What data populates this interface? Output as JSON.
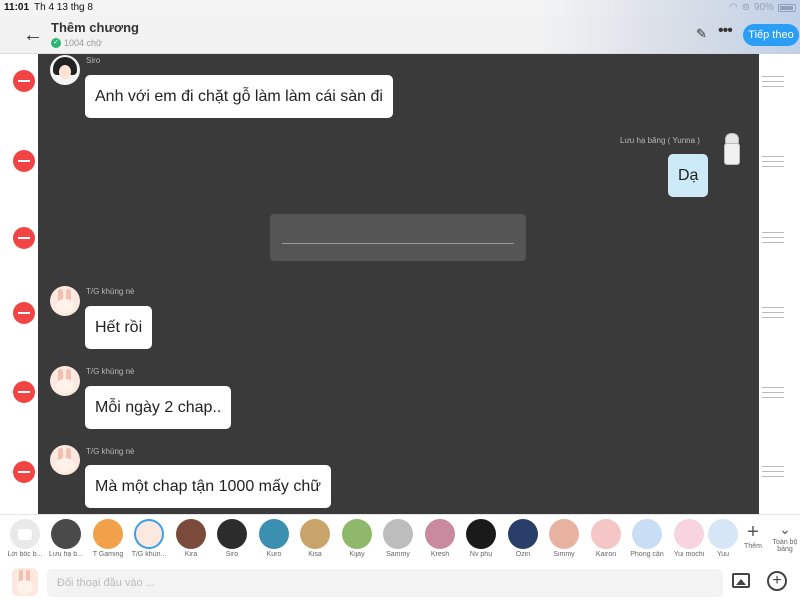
{
  "status_bar": {
    "time": "11:01",
    "date": "Th 4 13 thg 8",
    "battery": "90%"
  },
  "header": {
    "title": "Thêm chương",
    "word_count": "1004 chữ",
    "next_label": "Tiếp theo",
    "back_glyph": "←",
    "edit_glyph": "✎",
    "more_glyph": "•••"
  },
  "messages": [
    {
      "sender": "Siro",
      "text": "Anh với em đi chặt gỗ làm làm cái sàn đi",
      "side": "left",
      "avatar": "siro"
    },
    {
      "sender": "Lưu hạ băng ( Yunna )",
      "text": "Dạ",
      "side": "right",
      "avatar": "yunna"
    },
    {
      "type": "divider"
    },
    {
      "sender": "T/G khùng nè",
      "text": "Hết rồi",
      "side": "left",
      "avatar": "bunny"
    },
    {
      "sender": "T/G khùng nè",
      "text": "Mỗi ngày 2 chap..",
      "side": "left",
      "avatar": "bunny"
    },
    {
      "sender": "T/G khùng nè",
      "text": "Mà một chap tận 1000 mấy chữ",
      "side": "left",
      "avatar": "bunny"
    }
  ],
  "characters": [
    {
      "name": "Lời bốc b...",
      "color": "#e9e9e9"
    },
    {
      "name": "Lưu hạ b...",
      "color": "#4a4a4a"
    },
    {
      "name": "T Gaming",
      "color": "#f2a14a"
    },
    {
      "name": "T/G khùn...",
      "color": "#fbe9e0"
    },
    {
      "name": "Kira",
      "color": "#7a4a3a"
    },
    {
      "name": "Siro",
      "color": "#2c2c2c"
    },
    {
      "name": "Kuro",
      "color": "#3b8fb0"
    },
    {
      "name": "Kisa",
      "color": "#c9a46a"
    },
    {
      "name": "Kijay",
      "color": "#8fb86a"
    },
    {
      "name": "Sammy",
      "color": "#bdbdbd"
    },
    {
      "name": "Kresh",
      "color": "#c98aa0"
    },
    {
      "name": "Nv phụ",
      "color": "#1a1a1a"
    },
    {
      "name": "Ozin",
      "color": "#2a3e6a"
    },
    {
      "name": "Simmy",
      "color": "#e8b2a0"
    },
    {
      "name": "Kairon",
      "color": "#f5c6c6"
    },
    {
      "name": "Phong cận",
      "color": "#c9def5"
    },
    {
      "name": "Yui mochi",
      "color": "#f7d4e0"
    },
    {
      "name": "Yuu",
      "color": "#d6e6f7"
    }
  ],
  "strip": {
    "more_label": "Thêm",
    "all_label": "Toàn bộ bảng",
    "plus_glyph": "+",
    "chevron_glyph": "⌄"
  },
  "input": {
    "placeholder": "Đối thoại đầu vào ...",
    "add_glyph": "+"
  }
}
